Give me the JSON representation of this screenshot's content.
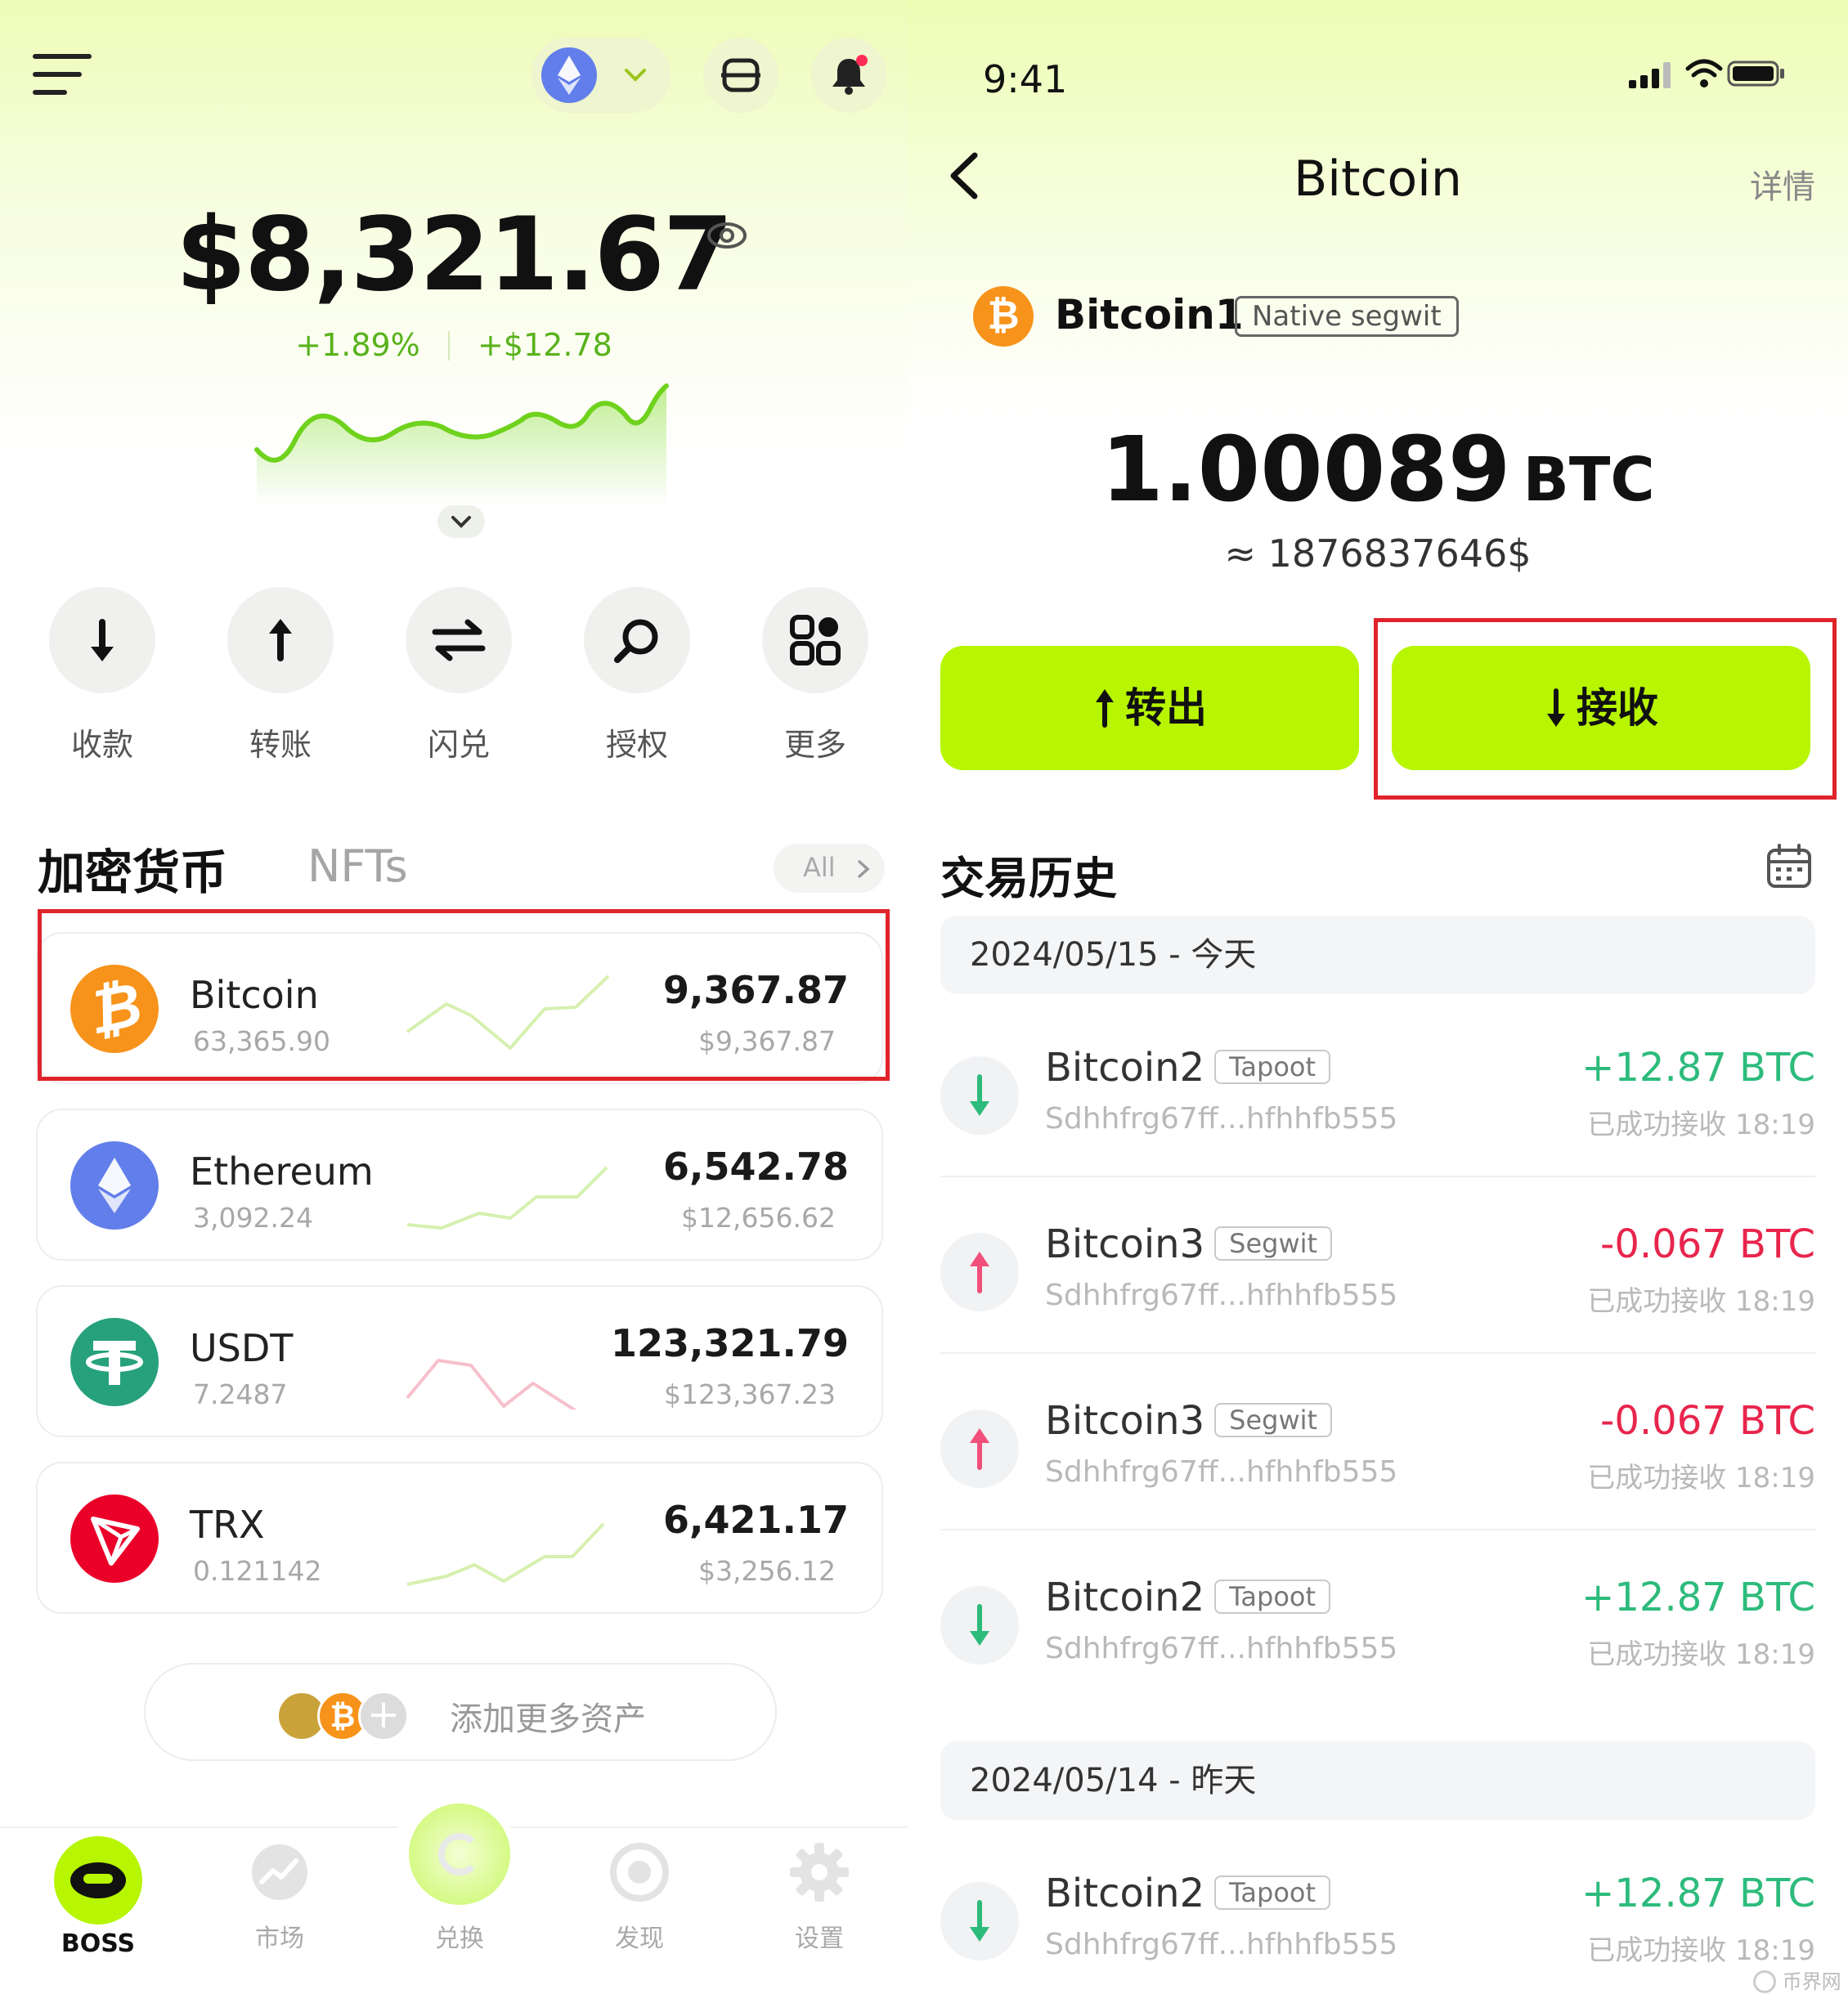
{
  "wallet": {
    "network_icon": "ethereum-icon",
    "total_balance": "$8,321.67",
    "change_percent": "+1.89%",
    "change_amount": "+$12.78",
    "actions": [
      {
        "label": "收款",
        "icon": "arrow-down-icon"
      },
      {
        "label": "转账",
        "icon": "arrow-up-icon"
      },
      {
        "label": "闪兑",
        "icon": "swap-icon"
      },
      {
        "label": "授权",
        "icon": "search-icon"
      },
      {
        "label": "更多",
        "icon": "grid-icon"
      }
    ],
    "tabs": {
      "crypto": "加密货币",
      "nfts": "NFTs",
      "all": "All"
    },
    "assets": [
      {
        "name": "Bitcoin",
        "price": "63,365.90",
        "amount": "9,367.87",
        "value": "$9,367.87",
        "trend": "up",
        "color": "#f7931a",
        "icon": "bitcoin-icon"
      },
      {
        "name": "Ethereum",
        "price": "3,092.24",
        "amount": "6,542.78",
        "value": "$12,656.62",
        "trend": "up",
        "color": "#627eea",
        "icon": "ethereum-icon"
      },
      {
        "name": "USDT",
        "price": "7.2487",
        "amount": "123,321.79",
        "value": "$123,367.23",
        "trend": "down",
        "color": "#26a17b",
        "icon": "tether-icon"
      },
      {
        "name": "TRX",
        "price": "0.121142",
        "amount": "6,421.17",
        "value": "$3,256.12",
        "trend": "up",
        "color": "#eb0029",
        "icon": "tron-icon"
      }
    ],
    "add_assets": "添加更多资产",
    "nav": [
      {
        "label": "BOSS",
        "icon": "boss-icon"
      },
      {
        "label": "市场",
        "icon": "market-icon"
      },
      {
        "label": "兑换",
        "icon": "exchange-icon"
      },
      {
        "label": "发现",
        "icon": "discover-icon"
      },
      {
        "label": "设置",
        "icon": "gear-icon"
      }
    ]
  },
  "detail": {
    "status_time": "9:41",
    "title": "Bitcoin",
    "detail_link": "详情",
    "account_name": "Bitcoin1",
    "account_tag": "Native segwit",
    "balance": "1.00089",
    "unit": "BTC",
    "fiat": "≈ 1876837646$",
    "send_label": "转出",
    "receive_label": "接收",
    "history_title": "交易历史",
    "groups": [
      {
        "date": "2024/05/15 - 今天",
        "items": [
          {
            "name": "Bitcoin2",
            "tag": "Tapoot",
            "addr": "Sdhhfrg67ff...hfhhfb555",
            "amount": "+12.87 BTC",
            "status": "已成功接收 18:19",
            "dir": "in"
          },
          {
            "name": "Bitcoin3",
            "tag": "Segwit",
            "addr": "Sdhhfrg67ff...hfhhfb555",
            "amount": "-0.067 BTC",
            "status": "已成功接收 18:19",
            "dir": "out"
          },
          {
            "name": "Bitcoin3",
            "tag": "Segwit",
            "addr": "Sdhhfrg67ff...hfhhfb555",
            "amount": "-0.067 BTC",
            "status": "已成功接收 18:19",
            "dir": "out"
          },
          {
            "name": "Bitcoin2",
            "tag": "Tapoot",
            "addr": "Sdhhfrg67ff...hfhhfb555",
            "amount": "+12.87 BTC",
            "status": "已成功接收 18:19",
            "dir": "in"
          }
        ]
      },
      {
        "date": "2024/05/14 - 昨天",
        "items": [
          {
            "name": "Bitcoin2",
            "tag": "Tapoot",
            "addr": "Sdhhfrg67ff...hfhhfb555",
            "amount": "+12.87 BTC",
            "status": "已成功接收 18:19",
            "dir": "in"
          }
        ]
      }
    ],
    "watermark": "币界网"
  },
  "colors": {
    "accent": "#b7f500",
    "positive": "#2dbb7c",
    "negative": "#e8254c",
    "highlight": "#e0232b",
    "chart_green": "#7ed321"
  }
}
